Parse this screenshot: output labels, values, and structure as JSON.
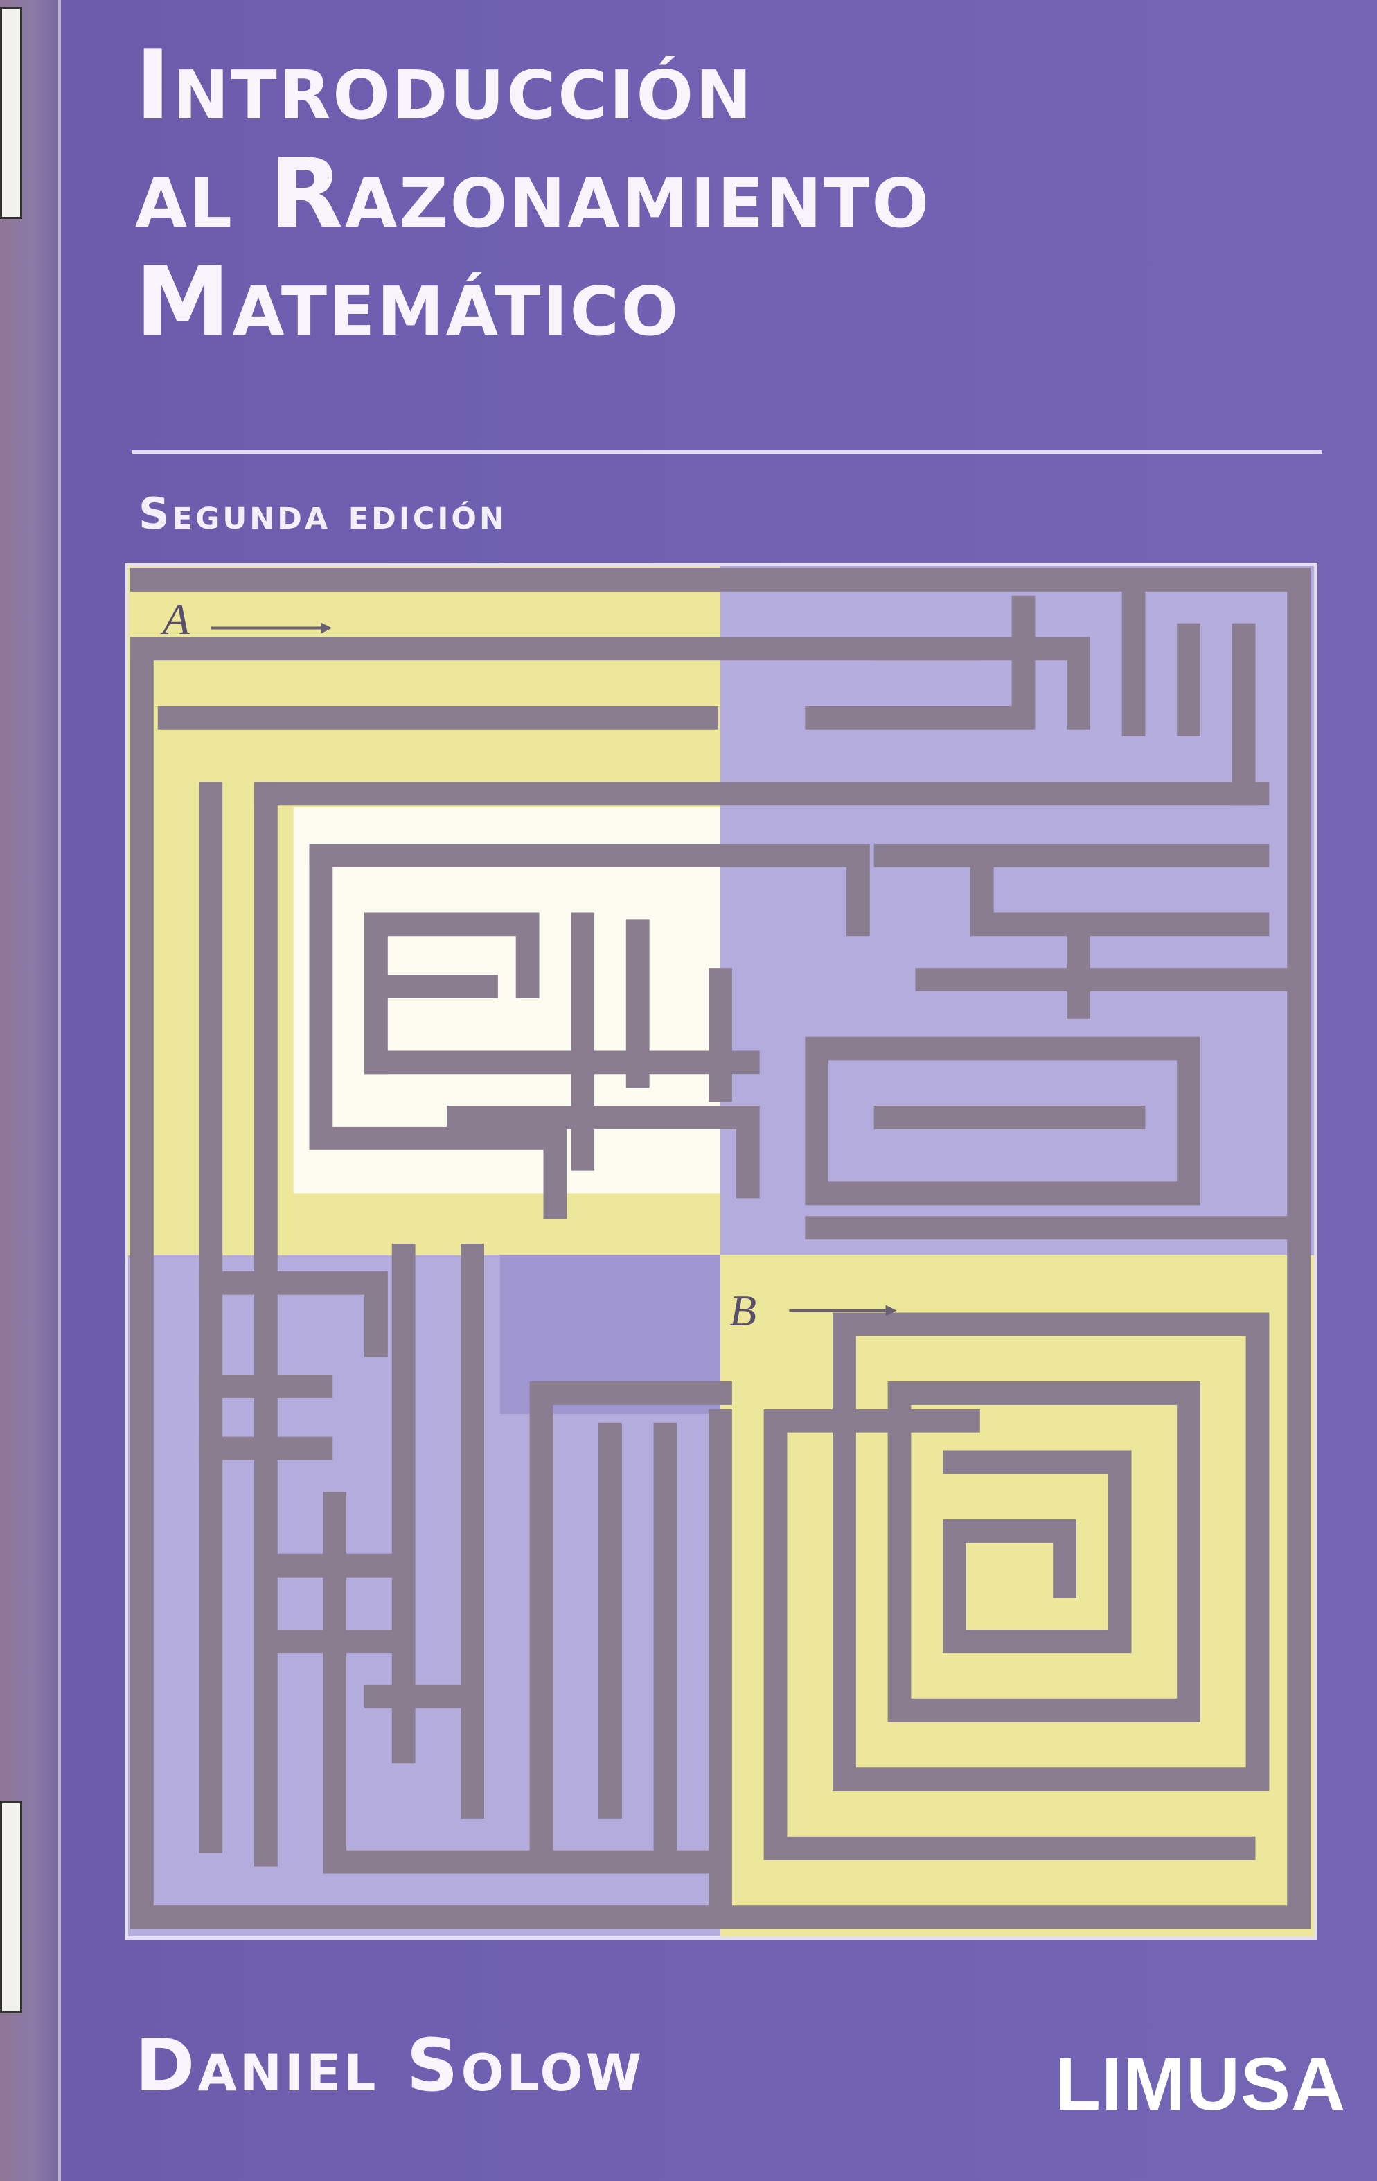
{
  "book": {
    "title_line1": "Introducción",
    "title_line2": "al Razonamiento",
    "title_line3": "Matemático",
    "edition": "Segunda edición",
    "author": "Daniel Solow",
    "publisher": "LIMUSA"
  },
  "maze": {
    "start_label": "A",
    "mid_label": "B"
  },
  "colors": {
    "background": "#6f60b2",
    "quadrant_yellow": "#ece79a",
    "quadrant_lavender": "#b5acde",
    "maze_walls": "#8a7d90",
    "text": "#f7f4fb"
  }
}
